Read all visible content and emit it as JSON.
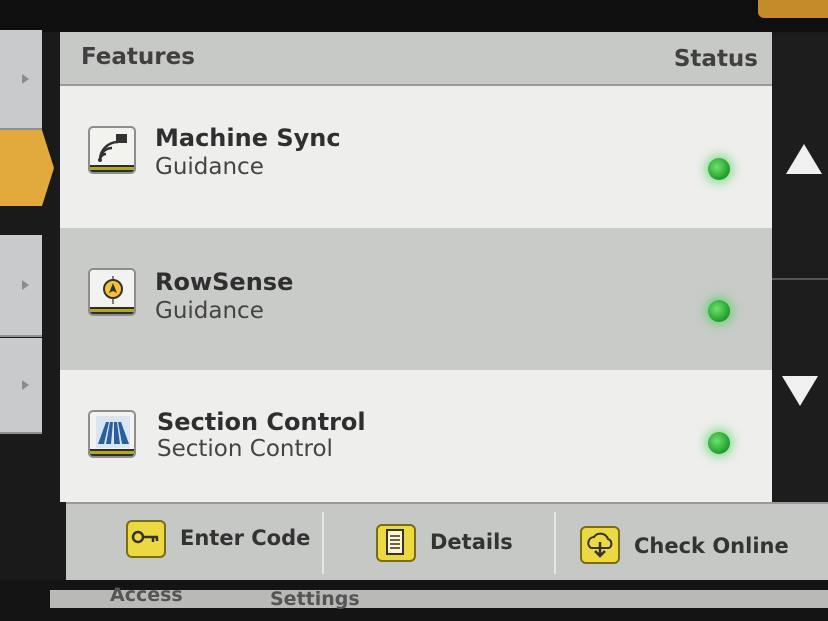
{
  "header": {
    "features_label": "Features",
    "status_label": "Status"
  },
  "features": [
    {
      "title": "Machine Sync",
      "subtitle": "Guidance",
      "icon": "machine-sync-icon",
      "status": "active",
      "status_color": "#2ecc40"
    },
    {
      "title": "RowSense",
      "subtitle": "Guidance",
      "icon": "rowsense-icon",
      "status": "active",
      "status_color": "#2ecc40"
    },
    {
      "title": "Section Control",
      "subtitle": "Section Control",
      "icon": "section-control-icon",
      "status": "active",
      "status_color": "#2ecc40"
    }
  ],
  "toolbar": {
    "enter_code_label": "Enter Code",
    "details_label": "Details",
    "check_online_label": "Check Online"
  },
  "bottom_tabs": {
    "access_label": "Access",
    "settings_label": "Settings"
  },
  "colors": {
    "accent": "#e2a93c",
    "button_yellow": "#ecd840",
    "status_green": "#2ecc40"
  }
}
